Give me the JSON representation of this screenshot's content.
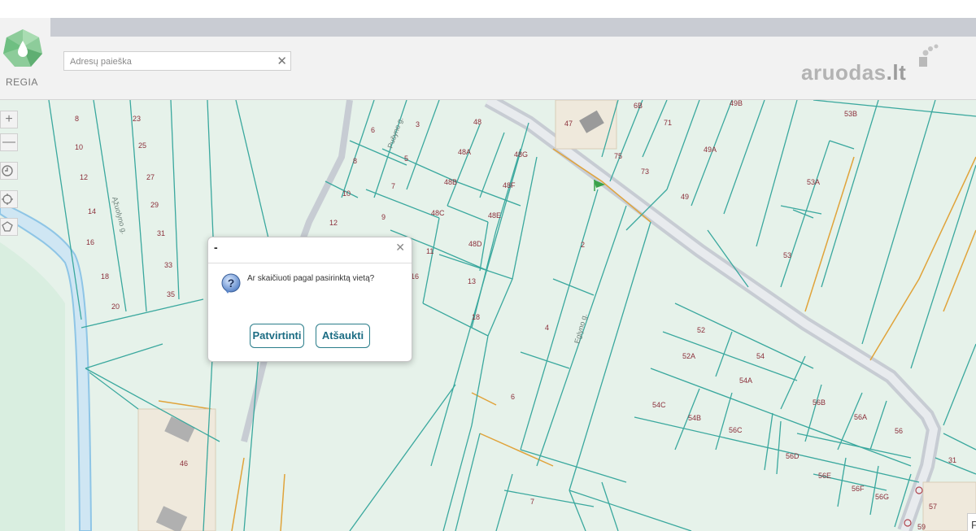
{
  "header": {
    "logo_text": "REGIA",
    "search": {
      "placeholder": "Adresų paieška",
      "value": "",
      "clear_label": "✕"
    },
    "brand_text": "aruodas",
    "brand_suffix": ".lt"
  },
  "map": {
    "controls": {
      "zoom_in": "+",
      "zoom_out": "—"
    },
    "side_tab_label": "F",
    "streets": [
      "Ąžuolyno g.",
      "Pušyno g.",
      "Eglyno g."
    ],
    "lot_labels": [
      "8",
      "10",
      "12",
      "14",
      "16",
      "18",
      "20",
      "23",
      "25",
      "27",
      "29",
      "31",
      "33",
      "35",
      "6",
      "8",
      "10",
      "12",
      "3",
      "5",
      "7",
      "9",
      "11",
      "13",
      "16",
      "18",
      "48",
      "48A",
      "48B",
      "48C",
      "48D",
      "48E",
      "48F",
      "48G",
      "47",
      "6B",
      "71",
      "49B",
      "75",
      "73",
      "49A",
      "49",
      "53B",
      "53A",
      "53",
      "2",
      "4",
      "6",
      "7",
      "52",
      "52A",
      "54",
      "54A",
      "54C",
      "54B",
      "56C",
      "56B",
      "56A",
      "56",
      "56D",
      "56E",
      "56F",
      "56G",
      "31",
      "57",
      "59",
      "46"
    ],
    "colors": {
      "land": "#e6f2ea",
      "parcel_line": "#3aa89e",
      "boundary": "#e0a33a",
      "road": "#c7ccd3"
    }
  },
  "dialog": {
    "title": "-",
    "close_label": "✕",
    "icon": "question-icon",
    "message": "Ar skaičiuoti pagal pasirinktą vietą?",
    "confirm_label": "Patvirtinti",
    "cancel_label": "Atšaukti"
  }
}
